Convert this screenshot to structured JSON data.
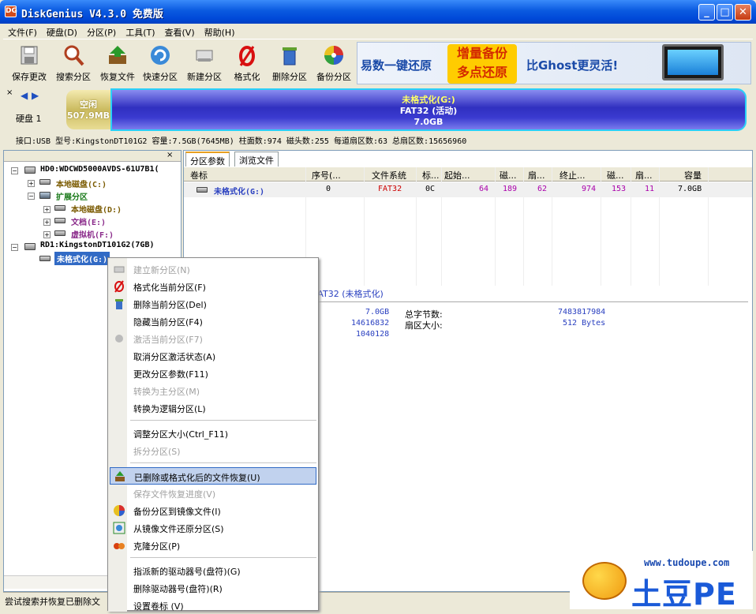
{
  "window": {
    "title": "DiskGenius V4.3.0 免费版",
    "app_icon": "DG"
  },
  "menu": [
    "文件(F)",
    "硬盘(D)",
    "分区(P)",
    "工具(T)",
    "查看(V)",
    "帮助(H)"
  ],
  "toolbar": [
    {
      "label": "保存更改",
      "icon": "save-icon"
    },
    {
      "label": "搜索分区",
      "icon": "magnifier-icon"
    },
    {
      "label": "恢复文件",
      "icon": "restore-box-icon"
    },
    {
      "label": "快速分区",
      "icon": "quick-partition-icon"
    },
    {
      "label": "新建分区",
      "icon": "new-partition-icon"
    },
    {
      "label": "格式化",
      "icon": "format-icon"
    },
    {
      "label": "删除分区",
      "icon": "trash-icon"
    },
    {
      "label": "备份分区",
      "icon": "backup-disc-icon"
    }
  ],
  "banner": {
    "text1": "易数一键还原",
    "text2a": "增量备份",
    "text2b": "多点还原",
    "text3": "比Ghost更灵活!"
  },
  "disk_nav": {
    "label": "硬盘 1"
  },
  "disk_map": {
    "free_label": "空闲",
    "free_size": "507.9MB",
    "part_name": "未格式化(G:)",
    "part_fs": "FAT32 (活动)",
    "part_size": "7.0GB"
  },
  "disk_info": "接口:USB  型号:KingstonDT101G2  容量:7.5GB(7645MB)  柱面数:974  磁头数:255  每道扇区数:63  总扇区数:15656960",
  "tree": [
    {
      "label": "HD0:WDCWD5000AVDS-61U7B1(",
      "color": "#000000"
    },
    {
      "label": "本地磁盘(C:)",
      "color": "#7a5a00"
    },
    {
      "label": "扩展分区",
      "color": "#1a7a1a"
    },
    {
      "label": "本地磁盘(D:)",
      "color": "#7a5a00"
    },
    {
      "label": "文档(E:)",
      "color": "#8a2a8a"
    },
    {
      "label": "虚拟机(F:)",
      "color": "#8a2a8a"
    },
    {
      "label": "RD1:KingstonDT101G2(7GB)",
      "color": "#000000"
    },
    {
      "label": "未格式化(G:)",
      "color": "#ffffff"
    }
  ],
  "tabs": [
    "分区参数",
    "浏览文件"
  ],
  "grid": {
    "headers": [
      "卷标",
      "序号(...",
      "文件系统",
      "标...",
      "起始...",
      "磁...",
      "扇...",
      "终止...",
      "磁...",
      "扇...",
      "容量"
    ],
    "row": [
      "未格式化(G:)",
      "0",
      "FAT32",
      "0C",
      "64",
      "189",
      "62",
      "974",
      "153",
      "11",
      "7.0GB"
    ]
  },
  "details": {
    "fs_title": "FAT32 (未格式化)",
    "v1": "7.0GB",
    "v2": "14616832",
    "v3": "1040128",
    "k1": "总字节数:",
    "k1v": "7483817984",
    "k2": "扇区大小:",
    "k2v": "512 Bytes"
  },
  "context_menu": [
    {
      "label": "建立新分区(N)",
      "disabled": true,
      "icon": "new-partition-icon"
    },
    {
      "label": "格式化当前分区(F)",
      "disabled": false,
      "icon": "format-icon"
    },
    {
      "label": "删除当前分区(Del)",
      "disabled": false,
      "icon": "trash-icon"
    },
    {
      "label": "隐藏当前分区(F4)",
      "disabled": false,
      "icon": ""
    },
    {
      "label": "激活当前分区(F7)",
      "disabled": true,
      "icon": "activate-icon"
    },
    {
      "label": "取消分区激活状态(A)",
      "disabled": false,
      "icon": ""
    },
    {
      "label": "更改分区参数(F11)",
      "disabled": false,
      "icon": ""
    },
    {
      "label": "转换为主分区(M)",
      "disabled": true,
      "icon": ""
    },
    {
      "label": "转换为逻辑分区(L)",
      "disabled": false,
      "icon": ""
    },
    {
      "label": "调整分区大小(Ctrl_F11)",
      "disabled": false,
      "icon": ""
    },
    {
      "label": "拆分分区(S)",
      "disabled": true,
      "icon": ""
    },
    {
      "label": "已删除或格式化后的文件恢复(U)",
      "disabled": false,
      "icon": "restore-box-icon"
    },
    {
      "label": "保存文件恢复进度(V)",
      "disabled": true,
      "icon": ""
    },
    {
      "label": "备份分区到镜像文件(I)",
      "disabled": false,
      "icon": "backup-disc-icon"
    },
    {
      "label": "从镜像文件还原分区(S)",
      "disabled": false,
      "icon": "restore-image-icon"
    },
    {
      "label": "克隆分区(P)",
      "disabled": false,
      "icon": "clone-icon"
    },
    {
      "label": "指派新的驱动器号(盘符)(G)",
      "disabled": false,
      "icon": ""
    },
    {
      "label": "删除驱动器号(盘符)(R)",
      "disabled": false,
      "icon": ""
    },
    {
      "label": "设置卷标  (V)",
      "disabled": false,
      "icon": ""
    }
  ],
  "status": "尝试搜索并恢复已删除文",
  "watermark": {
    "url": "www.tudoupe.com",
    "brand": "土豆PE"
  }
}
